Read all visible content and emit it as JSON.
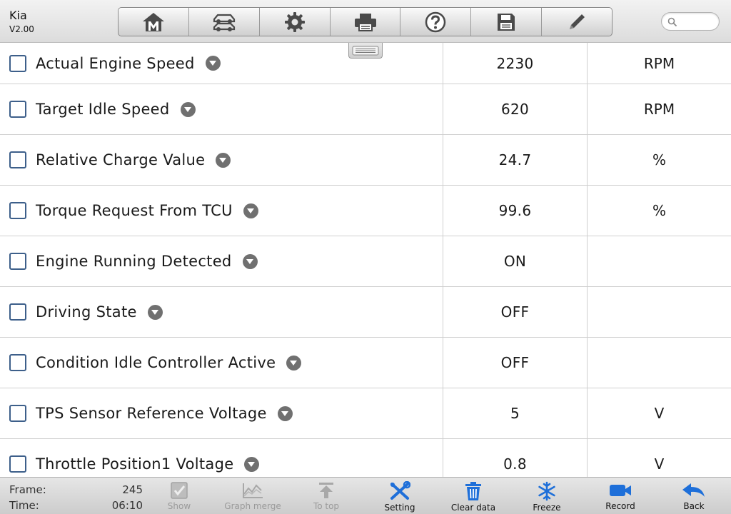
{
  "header": {
    "brand": "Kia",
    "version": "V2.00",
    "toolbar": [
      "home-icon",
      "vehicle-icon",
      "gear-icon",
      "printer-icon",
      "help-icon",
      "save-icon",
      "pencil-icon"
    ],
    "search_placeholder": ""
  },
  "rows": [
    {
      "name": "Actual Engine Speed",
      "value": "2230",
      "unit": "RPM"
    },
    {
      "name": "Target Idle Speed",
      "value": "620",
      "unit": "RPM"
    },
    {
      "name": "Relative Charge Value",
      "value": "24.7",
      "unit": "%"
    },
    {
      "name": "Torque Request From TCU",
      "value": "99.6",
      "unit": "%"
    },
    {
      "name": "Engine Running Detected",
      "value": "ON",
      "unit": ""
    },
    {
      "name": "Driving State",
      "value": "OFF",
      "unit": ""
    },
    {
      "name": "Condition Idle Controller Active",
      "value": "OFF",
      "unit": ""
    },
    {
      "name": "TPS Sensor Reference Voltage",
      "value": "5",
      "unit": "V"
    },
    {
      "name": "Throttle Position1 Voltage",
      "value": "0.8",
      "unit": "V"
    }
  ],
  "footer": {
    "frame_label": "Frame:",
    "frame_value": "245",
    "time_label": "Time:",
    "time_value": "06:10",
    "buttons": [
      {
        "label": "Show",
        "icon": "checkbox-icon",
        "enabled": false
      },
      {
        "label": "Graph merge",
        "icon": "graph-icon",
        "enabled": false
      },
      {
        "label": "To top",
        "icon": "to-top-icon",
        "enabled": false
      },
      {
        "label": "Setting",
        "icon": "wrench-icon",
        "enabled": true
      },
      {
        "label": "Clear data",
        "icon": "trash-icon",
        "enabled": true
      },
      {
        "label": "Freeze",
        "icon": "snowflake-icon",
        "enabled": true
      },
      {
        "label": "Record",
        "icon": "video-icon",
        "enabled": true
      },
      {
        "label": "Back",
        "icon": "back-arrow-icon",
        "enabled": true
      }
    ]
  },
  "colors": {
    "accent": "#1e6fd9",
    "disabled": "#9a9a9a"
  }
}
